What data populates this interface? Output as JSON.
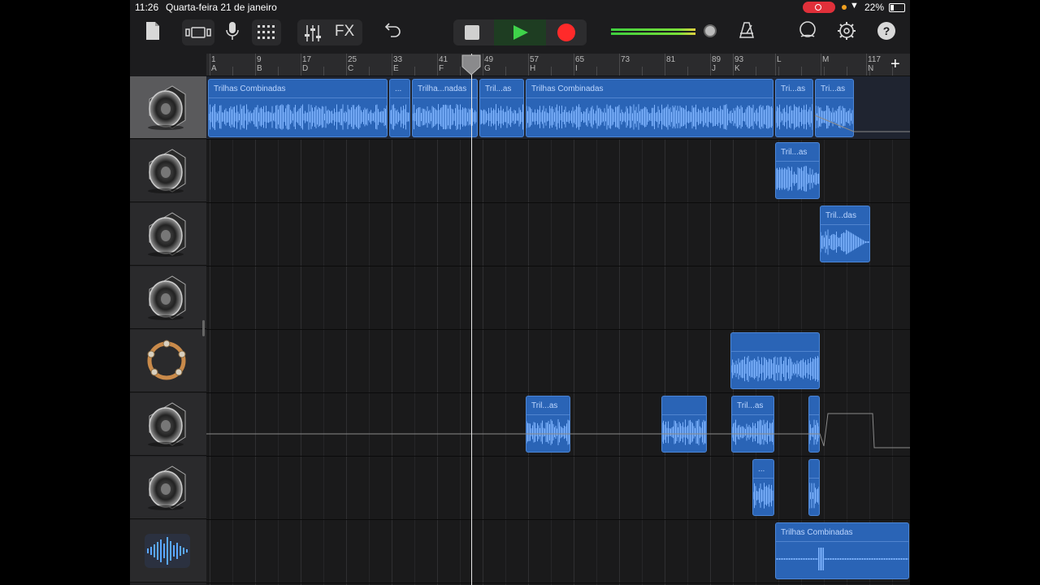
{
  "status": {
    "time": "11:26",
    "date": "Quarta-feira 21 de janeiro",
    "battery": "22%"
  },
  "toolbar": {
    "fx_label": "FX",
    "help_label": "?",
    "icons": [
      "document-icon",
      "view-toggle-icon",
      "microphone-icon",
      "grid-icon",
      "mixer-icon",
      "fx-icon",
      "undo-icon",
      "stop-icon",
      "play-icon",
      "record-icon",
      "metronome-icon",
      "loop-icon",
      "settings-icon",
      "help-icon"
    ],
    "colors": {
      "play": "#3fd24a",
      "record": "#ff2a2a",
      "region": "#2a64b6"
    }
  },
  "ruler": {
    "bars": [
      {
        "num": "1",
        "letter": "A"
      },
      {
        "num": "9",
        "letter": "B"
      },
      {
        "num": "17",
        "letter": "D"
      },
      {
        "num": "25",
        "letter": "C"
      },
      {
        "num": "33",
        "letter": "E"
      },
      {
        "num": "41",
        "letter": "F"
      },
      {
        "num": "49",
        "letter": "G"
      },
      {
        "num": "57",
        "letter": "H"
      },
      {
        "num": "65",
        "letter": "I"
      },
      {
        "num": "73",
        "letter": ""
      },
      {
        "num": "81",
        "letter": ""
      },
      {
        "num": "89",
        "letter": "J"
      },
      {
        "num": "93",
        "letter": "K"
      },
      {
        "num": "",
        "letter": "L"
      },
      {
        "num": "",
        "letter": "M"
      },
      {
        "num": "117",
        "letter": "N"
      }
    ],
    "add_label": "+"
  },
  "tracks": [
    {
      "instrument": "speaker-icon",
      "selected": true
    },
    {
      "instrument": "speaker-icon",
      "selected": false
    },
    {
      "instrument": "speaker-icon",
      "selected": false
    },
    {
      "instrument": "speaker-icon",
      "selected": false
    },
    {
      "instrument": "tambourine-icon",
      "selected": false
    },
    {
      "instrument": "speaker-icon",
      "selected": false
    },
    {
      "instrument": "speaker-icon",
      "selected": false
    },
    {
      "instrument": "audio-recorder-icon",
      "selected": false
    }
  ],
  "regions": [
    {
      "track": 0,
      "label": "Trilhas Combinadas"
    },
    {
      "track": 0,
      "label": "..."
    },
    {
      "track": 0,
      "label": "Trilha...nadas"
    },
    {
      "track": 0,
      "label": "Tril...as"
    },
    {
      "track": 0,
      "label": "Trilhas Combinadas"
    },
    {
      "track": 0,
      "label": "Tri...as"
    },
    {
      "track": 0,
      "label": "Tri...as"
    },
    {
      "track": 1,
      "label": "Tril...as"
    },
    {
      "track": 2,
      "label": "Tril...das"
    },
    {
      "track": 4,
      "label": ""
    },
    {
      "track": 5,
      "label": "Tril...as"
    },
    {
      "track": 5,
      "label": ""
    },
    {
      "track": 5,
      "label": "Tril...as"
    },
    {
      "track": 5,
      "label": ""
    },
    {
      "track": 6,
      "label": "..."
    },
    {
      "track": 6,
      "label": ""
    },
    {
      "track": 7,
      "label": "Trilhas Combinadas"
    }
  ]
}
